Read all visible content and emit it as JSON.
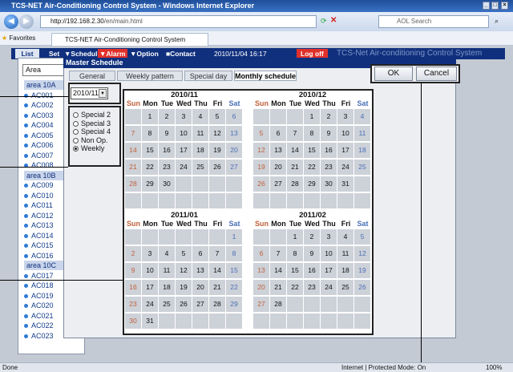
{
  "browser": {
    "title": "TCS-NET Air-Conditioning Control System - Windows Internet Explorer",
    "url_host": "http://192.168.2.30",
    "url_path": "/en/main.html",
    "search_placeholder": "AOL Search",
    "favorites": "Favorites",
    "tab_title": "TCS-NET Air-Conditioning Control System",
    "status_done": "Done",
    "status_zone": "Internet | Protected Mode: On",
    "zoom": "100%"
  },
  "app": {
    "tabs": [
      "List",
      "Set"
    ],
    "menu": [
      "▼Schedule",
      "▼Alarm",
      "▼Option",
      "■Contact"
    ],
    "datetime": "2010/11/04 16:17",
    "logoff": "Log off",
    "brand": "TCS-Net Air-conditioning Control System",
    "area_select": "Area",
    "tree": [
      {
        "type": "area",
        "label": "area 10A"
      },
      {
        "type": "item",
        "label": "AC001"
      },
      {
        "type": "item",
        "label": "AC002"
      },
      {
        "type": "item",
        "label": "AC003"
      },
      {
        "type": "item",
        "label": "AC004"
      },
      {
        "type": "item",
        "label": "AC005"
      },
      {
        "type": "item",
        "label": "AC006"
      },
      {
        "type": "item",
        "label": "AC007"
      },
      {
        "type": "item",
        "label": "AC008"
      },
      {
        "type": "area",
        "label": "area 10B"
      },
      {
        "type": "item",
        "label": "AC009"
      },
      {
        "type": "item",
        "label": "AC010"
      },
      {
        "type": "item",
        "label": "AC011"
      },
      {
        "type": "item",
        "label": "AC012"
      },
      {
        "type": "item",
        "label": "AC013"
      },
      {
        "type": "item",
        "label": "AC014"
      },
      {
        "type": "item",
        "label": "AC015"
      },
      {
        "type": "item",
        "label": "AC016"
      },
      {
        "type": "area",
        "label": "area 10C"
      },
      {
        "type": "item",
        "label": "AC017"
      },
      {
        "type": "item",
        "label": "AC018"
      },
      {
        "type": "item",
        "label": "AC019"
      },
      {
        "type": "item",
        "label": "AC020"
      },
      {
        "type": "item",
        "label": "AC021"
      },
      {
        "type": "item",
        "label": "AC022"
      },
      {
        "type": "item",
        "label": "AC023"
      }
    ]
  },
  "dialog": {
    "title": "Master Schedule",
    "tabs": [
      "General",
      "Weekly pattern",
      "Special day",
      "Monthly schedule"
    ],
    "ok": "OK",
    "cancel": "Cancel",
    "month_select": "2010/11",
    "radios": [
      "Special 2",
      "Special 3",
      "Special 4",
      "Non Op.",
      "Weekly"
    ],
    "selected_radio": "Weekly",
    "weekdays": [
      "Sun",
      "Mon",
      "Tue",
      "Wed",
      "Thu",
      "Fri",
      "Sat"
    ],
    "months": [
      {
        "title": "2010/11",
        "start": 1,
        "days": 30
      },
      {
        "title": "2010/12",
        "start": 3,
        "days": 31
      },
      {
        "title": "2011/01",
        "start": 6,
        "days": 31
      },
      {
        "title": "2011/02",
        "start": 2,
        "days": 28
      }
    ]
  },
  "colors": {
    "navy": "#10307e",
    "alarm": "#e0302a",
    "logoff": "#e0302a",
    "cell": "#cdd1d8"
  }
}
